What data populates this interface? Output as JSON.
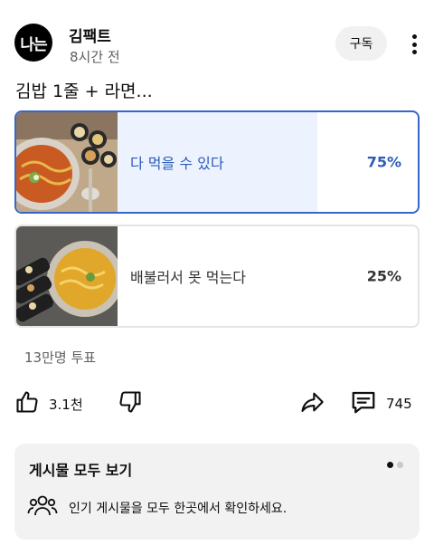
{
  "channel": {
    "avatar_text": "나는",
    "name": "김팩트",
    "time": "8시간 전",
    "subscribe_label": "구독"
  },
  "post": {
    "text": "김밥 1줄 + 라면..."
  },
  "poll": {
    "options": [
      {
        "label": "다 먹을 수 있다",
        "percent_label": "75%",
        "percent": 75,
        "selected": true
      },
      {
        "label": "배불러서 못 먹는다",
        "percent_label": "25%",
        "percent": 25,
        "selected": false
      }
    ],
    "votes": "13만명 투표"
  },
  "actions": {
    "like_count": "3.1천",
    "comment_count": "745"
  },
  "card": {
    "title": "게시물 모두 보기",
    "text": "인기 게시물을 모두 한곳에서 확인하세요.",
    "active_dot": 0
  },
  "colors": {
    "accent": "#3766c8",
    "selected_fill": "#ecf3ff",
    "unselected_fill": "#e8e8e8"
  },
  "icons": {
    "like": "thumbs-up-icon",
    "dislike": "thumbs-down-icon",
    "share": "share-arrow-icon",
    "comment": "comment-icon",
    "card": "people-icon"
  }
}
